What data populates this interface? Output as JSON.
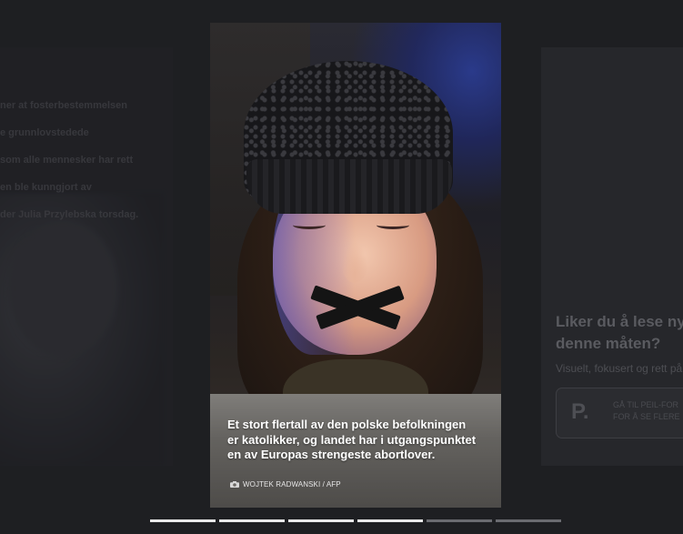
{
  "previous_story": {
    "text_lines": [
      "ner at fosterbestemmelsen",
      "e grunnlovstedede",
      "som alle mennesker har rett",
      "en ble kunngjort av",
      "der Julia Przylebska torsdag."
    ]
  },
  "story": {
    "caption_lines": [
      "Et stort flertall av den polske befolkningen",
      "er katolikker, og landet har i utgangspunktet",
      "en av Europas strengeste abortlover."
    ],
    "photo_credit": "WOJTEK RADWANSKI / AFP",
    "photo_subject": "Woman with black tape over her mouth wearing a knit hat"
  },
  "next_card": {
    "title_lines": [
      "Liker du å lese nyh",
      "denne måten?"
    ],
    "subtitle": "Visuelt, fokusert og rett på",
    "button_text_lines": [
      "GÅ TIL PEIL-FOR",
      "FOR Å SE FLERE"
    ],
    "logo_letter": "P."
  },
  "progress": {
    "total_segments": 6,
    "completed_segments": 4
  },
  "colors": {
    "background": "#1e1f22",
    "progress_done": "#e9e9e9",
    "progress_pending": "#6a6b70"
  }
}
